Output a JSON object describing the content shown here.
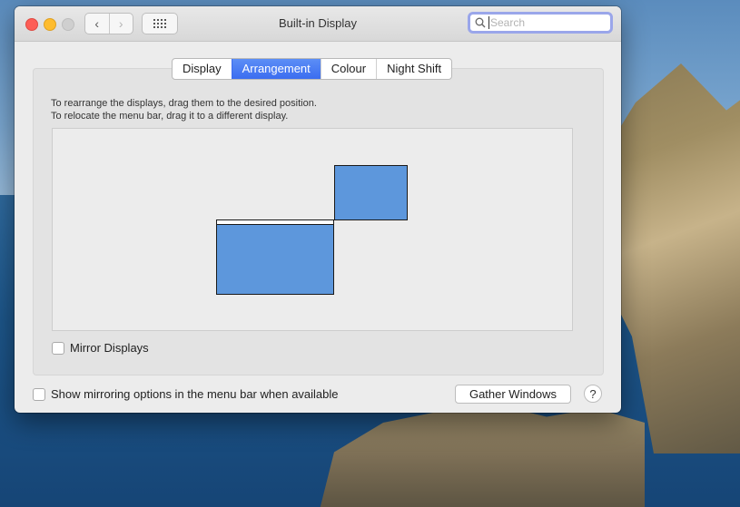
{
  "window": {
    "title": "Built-in Display"
  },
  "toolbar": {
    "back_glyph": "‹",
    "forward_glyph": "›",
    "show_all_icon": "grid-icon"
  },
  "search": {
    "placeholder": "Search",
    "value": ""
  },
  "tabs": [
    {
      "label": "Display",
      "active": false
    },
    {
      "label": "Arrangement",
      "active": true
    },
    {
      "label": "Colour",
      "active": false
    },
    {
      "label": "Night Shift",
      "active": false
    }
  ],
  "arrangement": {
    "instruction_line1": "To rearrange the displays, drag them to the desired position.",
    "instruction_line2": "To relocate the menu bar, drag it to a different display.",
    "display_color": "#5d97dc"
  },
  "mirror_displays": {
    "label": "Mirror Displays",
    "checked": false
  },
  "show_mirroring": {
    "label": "Show mirroring options in the menu bar when available",
    "checked": false
  },
  "buttons": {
    "gather_windows": "Gather Windows",
    "help": "?"
  },
  "colors": {
    "accent": "#3b6df0",
    "close": "#fd5e56",
    "minimize": "#febc2e"
  }
}
